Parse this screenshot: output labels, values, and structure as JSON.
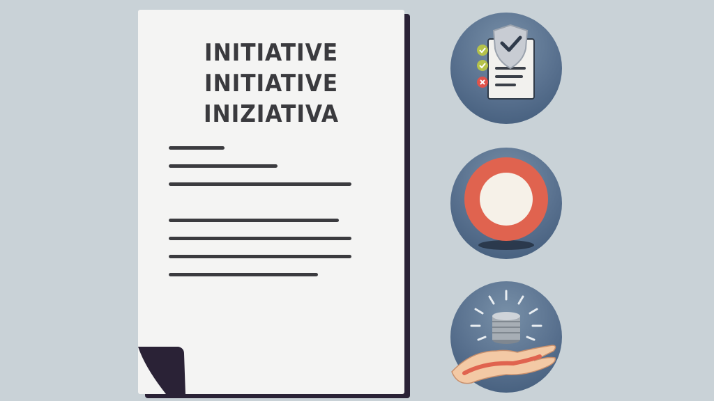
{
  "document": {
    "titles": [
      "INITIATIVE",
      "INITIATIVE",
      "INIZIATIVA"
    ]
  },
  "icons": [
    {
      "name": "checklist-shield-icon"
    },
    {
      "name": "ring-target-icon"
    },
    {
      "name": "coins-in-hand-icon"
    }
  ],
  "colors": {
    "background": "#c9d2d7",
    "paper": "#f4f4f3",
    "text": "#3a3a3e",
    "circle": "#58708e",
    "ring": "#e0634f",
    "check": "#b5c24a",
    "cross": "#e0534a"
  }
}
